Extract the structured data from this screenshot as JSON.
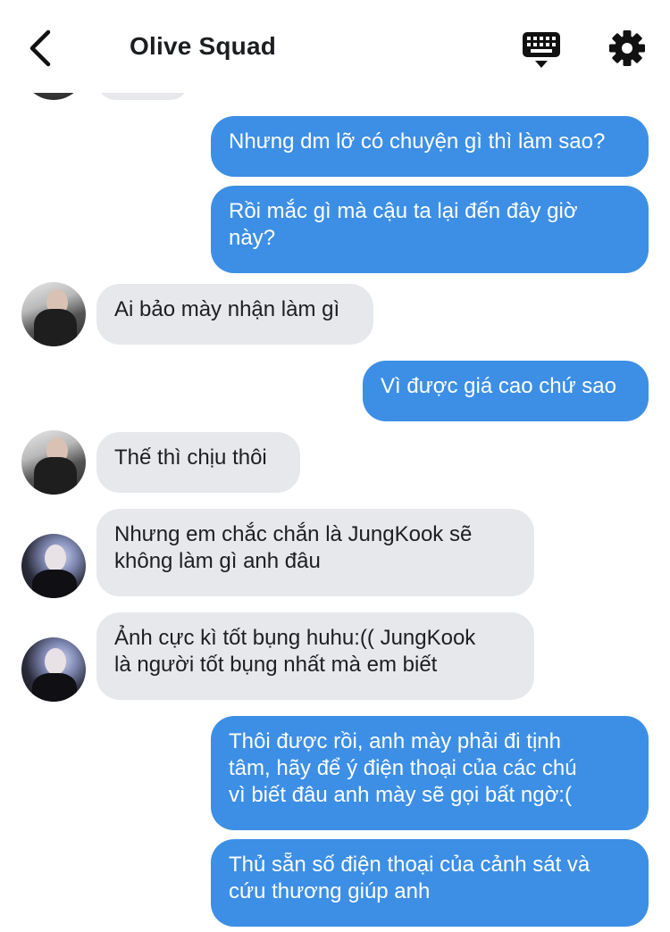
{
  "header": {
    "title": "Olive Squad",
    "back_icon": "chevron-left-icon",
    "keyboard_icon": "keyboard-icon",
    "settings_icon": "gear-icon"
  },
  "colors": {
    "outgoing_bubble": "#3d8fe6",
    "incoming_bubble": "#e6e8ec",
    "text_dark": "#1c1e21"
  },
  "messages": [
    {
      "side": "out",
      "text": "Nhưng dm lỡ có chuyện gì thì làm sao?"
    },
    {
      "side": "out",
      "text": "Rồi mắc gì mà cậu ta lại đến đây giờ\nnày?"
    },
    {
      "side": "in",
      "avatar": "avatar-a",
      "text": "Ai bảo mày nhận làm gì"
    },
    {
      "side": "out",
      "text": "Vì được giá cao chứ sao"
    },
    {
      "side": "in",
      "avatar": "avatar-a",
      "text": "Thế thì chịu thôi"
    },
    {
      "side": "in",
      "avatar": "avatar-b",
      "text": "Nhưng em chắc chắn là JungKook sẽ\nkhông làm gì anh đâu"
    },
    {
      "side": "in",
      "avatar": "avatar-b",
      "text": "Ảnh cực kì tốt bụng huhu:(( JungKook\nlà người tốt bụng nhất mà em biết"
    },
    {
      "side": "out",
      "text": "Thôi được rồi, anh mày phải đi tịnh\ntâm, hãy để ý điện thoại của các chú\nvì biết đâu anh mày sẽ gọi bất ngờ:("
    },
    {
      "side": "out",
      "text": "Thủ sẵn số điện thoại của cảnh sát và\ncứu thương giúp anh"
    }
  ]
}
